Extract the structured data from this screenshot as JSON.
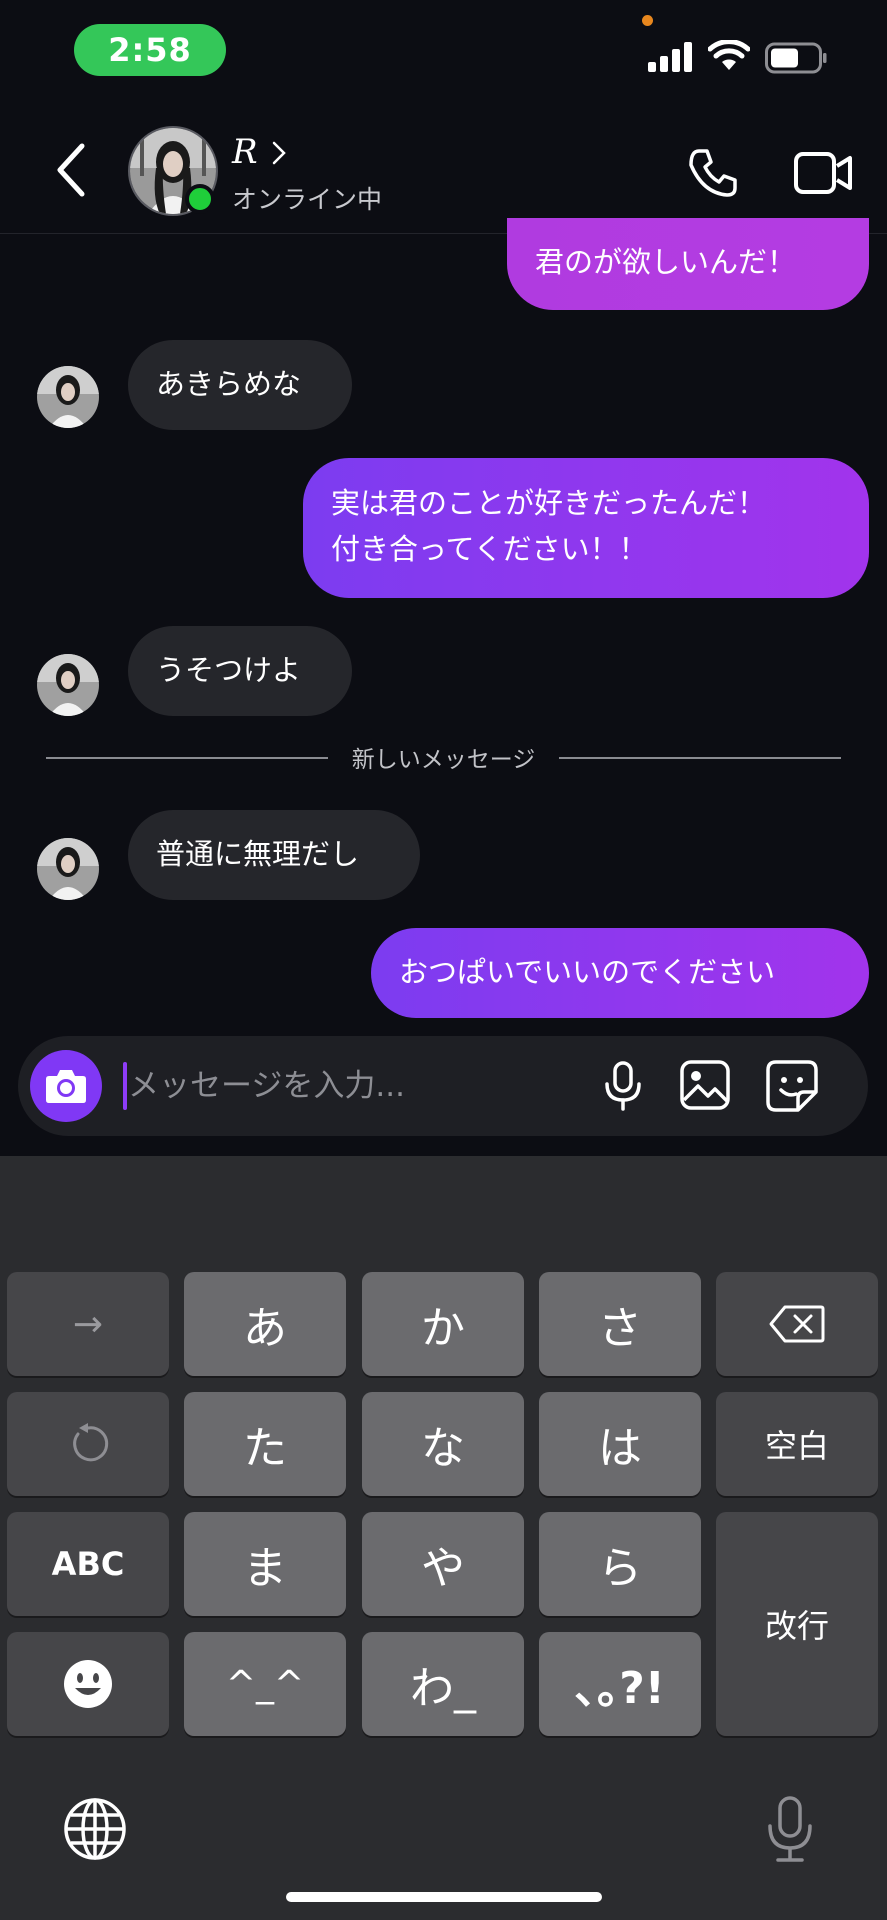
{
  "status_bar": {
    "time": "2:58"
  },
  "header": {
    "contact_name": "R",
    "contact_status": "オンライン中"
  },
  "messages": [
    {
      "from": "me",
      "text": "君のが欲しいんだ！"
    },
    {
      "from": "them",
      "text": "あきらめな"
    },
    {
      "from": "me",
      "lines": [
        "実は君のことが好きだったんだ！",
        "付き合ってください！！"
      ]
    },
    {
      "from": "them",
      "text": "うそつけよ"
    },
    {
      "from": "them",
      "text": "普通に無理だし"
    },
    {
      "from": "me",
      "text": "おつぱいでいいのでください"
    }
  ],
  "divider_label": "新しいメッセージ",
  "input": {
    "placeholder": "メッセージを入力...",
    "value": ""
  },
  "keyboard": {
    "row1": [
      "→",
      "あ",
      "か",
      "さ",
      "⌫"
    ],
    "row2": [
      "↺",
      "た",
      "な",
      "は",
      "空白"
    ],
    "row3": [
      "ABC",
      "ま",
      "や",
      "ら",
      "改行"
    ],
    "row4": [
      "☺",
      "^_^",
      "わ_",
      "､｡?!"
    ]
  },
  "colors": {
    "accent_purple": "#8038f5",
    "bubble_out_start": "#7c3cf0",
    "bubble_out_end": "#a234ec",
    "bubble_in": "#25262b",
    "online_green": "#1fce3a",
    "time_pill": "#34c759"
  }
}
